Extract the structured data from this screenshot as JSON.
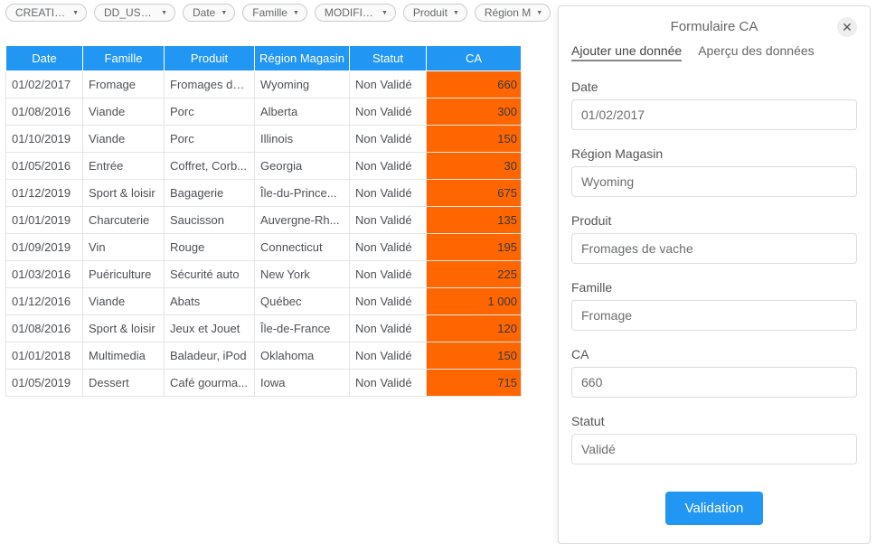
{
  "filters": [
    {
      "label": "CREATIO..."
    },
    {
      "label": "DD_USER"
    },
    {
      "label": "Date"
    },
    {
      "label": "Famille"
    },
    {
      "label": "MODIFICA..."
    },
    {
      "label": "Produit"
    },
    {
      "label": "Région M"
    }
  ],
  "table": {
    "headers": {
      "date": "Date",
      "famille": "Famille",
      "produit": "Produit",
      "region": "Région Magasin",
      "statut": "Statut",
      "ca": "CA"
    },
    "rows": [
      {
        "date": "01/02/2017",
        "famille": "Fromage",
        "produit": "Fromages de...",
        "region": "Wyoming",
        "statut": "Non Validé",
        "ca": "660"
      },
      {
        "date": "01/08/2016",
        "famille": "Viande",
        "produit": "Porc",
        "region": "Alberta",
        "statut": "Non Validé",
        "ca": "300"
      },
      {
        "date": "01/10/2019",
        "famille": "Viande",
        "produit": "Porc",
        "region": "Illinois",
        "statut": "Non Validé",
        "ca": "150"
      },
      {
        "date": "01/05/2016",
        "famille": "Entrée",
        "produit": "Coffret, Corb...",
        "region": "Georgia",
        "statut": "Non Validé",
        "ca": "30"
      },
      {
        "date": "01/12/2019",
        "famille": "Sport & loisir",
        "produit": "Bagagerie",
        "region": "Île-du-Prince...",
        "statut": "Non Validé",
        "ca": "675"
      },
      {
        "date": "01/01/2019",
        "famille": "Charcuterie",
        "produit": "Saucisson",
        "region": "Auvergne-Rh...",
        "statut": "Non Validé",
        "ca": "135"
      },
      {
        "date": "01/09/2019",
        "famille": "Vin",
        "produit": "Rouge",
        "region": "Connecticut",
        "statut": "Non Validé",
        "ca": "195"
      },
      {
        "date": "01/03/2016",
        "famille": "Puériculture",
        "produit": "Sécurité auto",
        "region": "New York",
        "statut": "Non Validé",
        "ca": "225"
      },
      {
        "date": "01/12/2016",
        "famille": "Viande",
        "produit": "Abats",
        "region": "Québec",
        "statut": "Non Validé",
        "ca": "1 000"
      },
      {
        "date": "01/08/2016",
        "famille": "Sport & loisir",
        "produit": "Jeux et Jouet",
        "region": "Île-de-France",
        "statut": "Non Validé",
        "ca": "120"
      },
      {
        "date": "01/01/2018",
        "famille": "Multimedia",
        "produit": "Baladeur, iPod",
        "region": "Oklahoma",
        "statut": "Non Validé",
        "ca": "150"
      },
      {
        "date": "01/05/2019",
        "famille": "Dessert",
        "produit": "Café gourma...",
        "region": "Iowa",
        "statut": "Non Validé",
        "ca": "715"
      }
    ]
  },
  "panel": {
    "title": "Formulaire CA",
    "tabs": {
      "add": "Ajouter une donnée",
      "preview": "Aperçu des données"
    },
    "fields": {
      "date": {
        "label": "Date",
        "value": "01/02/2017"
      },
      "region": {
        "label": "Région Magasin",
        "value": "Wyoming"
      },
      "produit": {
        "label": "Produit",
        "value": "Fromages de vache"
      },
      "famille": {
        "label": "Famille",
        "value": "Fromage"
      },
      "ca": {
        "label": "CA",
        "value": "660"
      },
      "statut": {
        "label": "Statut",
        "value": "Validé"
      }
    },
    "button": "Validation"
  }
}
